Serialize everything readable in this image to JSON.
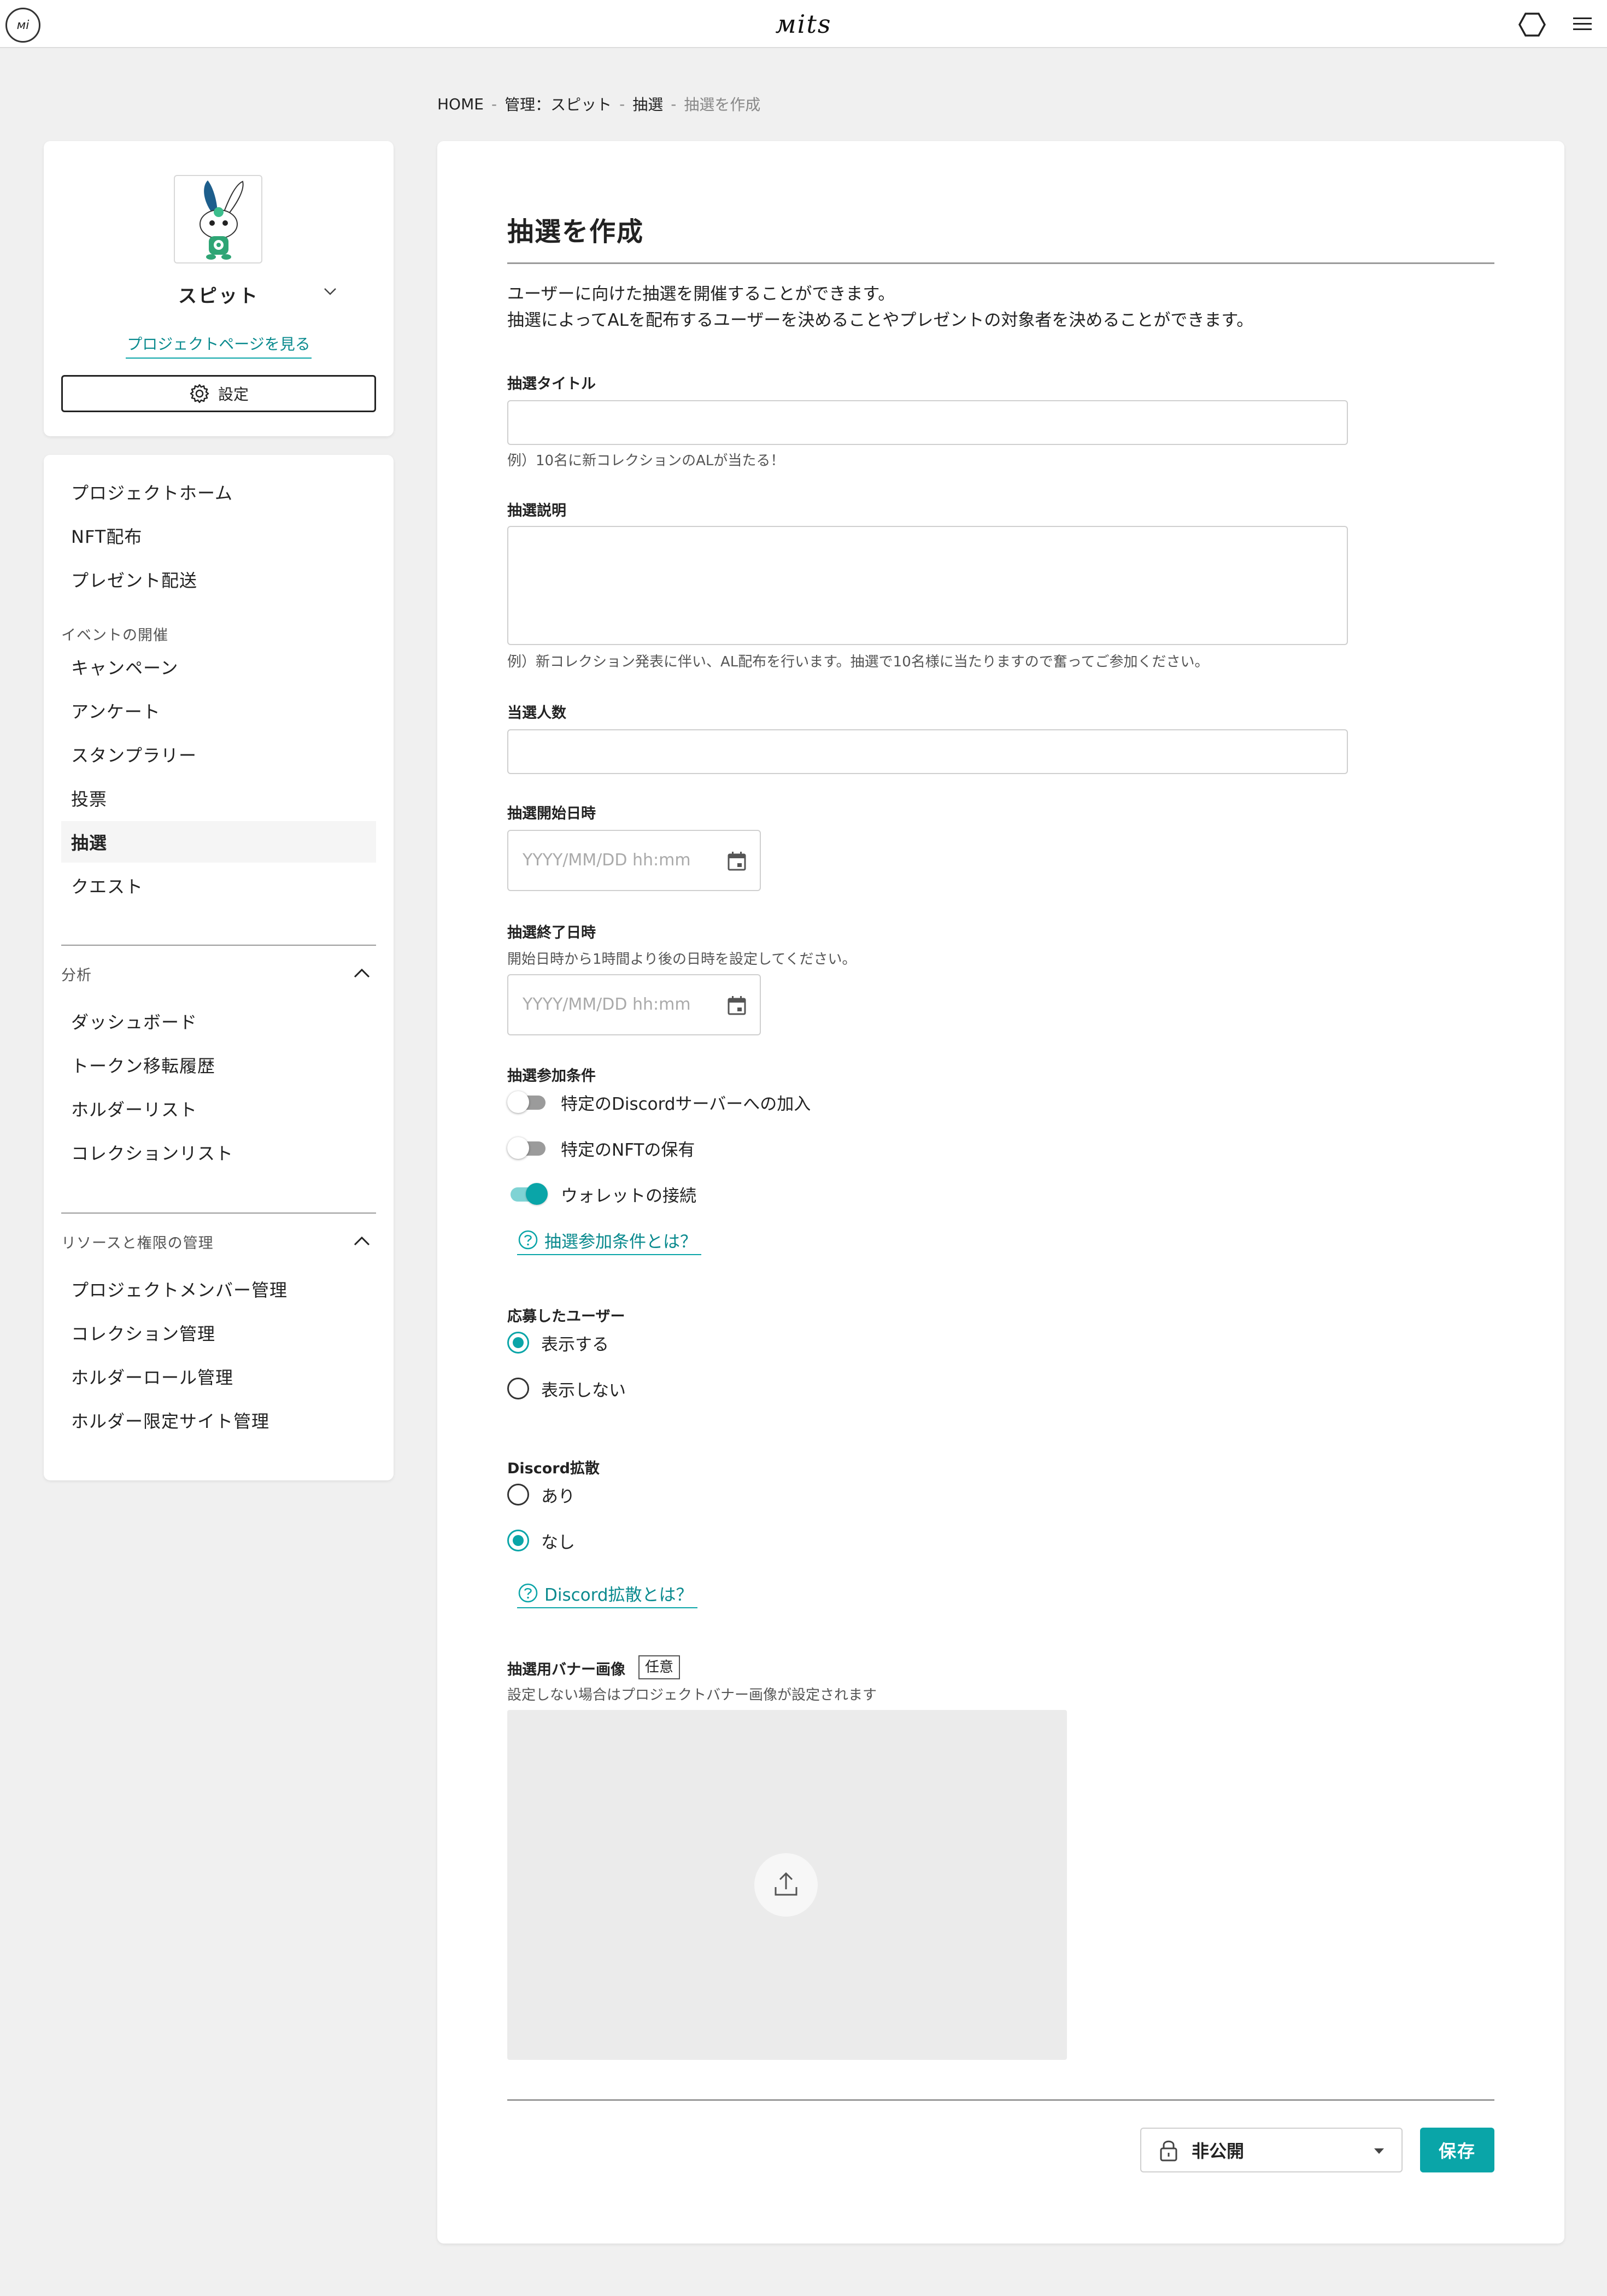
{
  "header": {
    "logo_badge": "мі",
    "brand": "мits",
    "icons": {
      "left": "mits-logo-icon",
      "right1": "hexagon-icon",
      "right2": "hamburger-menu-icon"
    }
  },
  "breadcrumb": {
    "items": [
      "HOME",
      "管理：スピット",
      "抽選"
    ],
    "current": "抽選を作成",
    "separator": "-"
  },
  "project": {
    "name": "スピット",
    "link": "プロジェクトページを見る",
    "settings_label": "設定"
  },
  "nav": {
    "top_items": [
      "プロジェクトホーム",
      "NFT配布",
      "プレゼント配送"
    ],
    "events_section": "イベントの開催",
    "event_items": [
      "キャンペーン",
      "アンケート",
      "スタンプラリー",
      "投票",
      "抽選",
      "クエスト"
    ],
    "active_item": "抽選",
    "analytics_section": "分析",
    "analytics_items": [
      "ダッシュボード",
      "トークン移転履歴",
      "ホルダーリスト",
      "コレクションリスト"
    ],
    "resources_section": "リソースと権限の管理",
    "resources_items": [
      "プロジェクトメンバー管理",
      "コレクション管理",
      "ホルダーロール管理",
      "ホルダー限定サイト管理"
    ]
  },
  "form": {
    "page_title": "抽選を作成",
    "intro_line1": "ユーザーに向けた抽選を開催することができます。",
    "intro_line2": "抽選によってALを配布するユーザーを決めることやプレゼントの対象者を決めることができます。",
    "title_label": "抽選タイトル",
    "title_value": "",
    "title_hint": "例）10名に新コレクションのALが当たる！",
    "desc_label": "抽選説明",
    "desc_value": "",
    "desc_hint": "例）新コレクション発表に伴い、AL配布を行います。抽選で10名様に当たりますので奮ってご参加ください。",
    "winners_label": "当選人数",
    "winners_value": "",
    "start_label": "抽選開始日時",
    "start_placeholder": "YYYY/MM/DD hh:mm",
    "end_label": "抽選終了日時",
    "end_hint": "開始日時から1時間より後の日時を設定してください。",
    "end_placeholder": "YYYY/MM/DD hh:mm",
    "conditions_label": "抽選参加条件",
    "conditions": [
      {
        "label": "特定のDiscordサーバーへの加入",
        "on": false
      },
      {
        "label": "特定のNFTの保有",
        "on": false
      },
      {
        "label": "ウォレットの接続",
        "on": true
      }
    ],
    "conditions_help": "抽選参加条件とは？",
    "applicants_label": "応募したユーザー",
    "applicants_options": [
      "表示する",
      "表示しない"
    ],
    "applicants_selected": "表示する",
    "discord_label": "Discord拡散",
    "discord_options": [
      "あり",
      "なし"
    ],
    "discord_selected": "なし",
    "discord_help": "Discord拡散とは？",
    "banner_label": "抽選用バナー画像",
    "banner_optional": "任意",
    "banner_hint": "設定しない場合はプロジェクトバナー画像が設定されます",
    "visibility_value": "非公開",
    "save_label": "保存"
  },
  "colors": {
    "accent": "#0aa5a8",
    "background": "#f0f0f0",
    "card": "#ffffff"
  }
}
